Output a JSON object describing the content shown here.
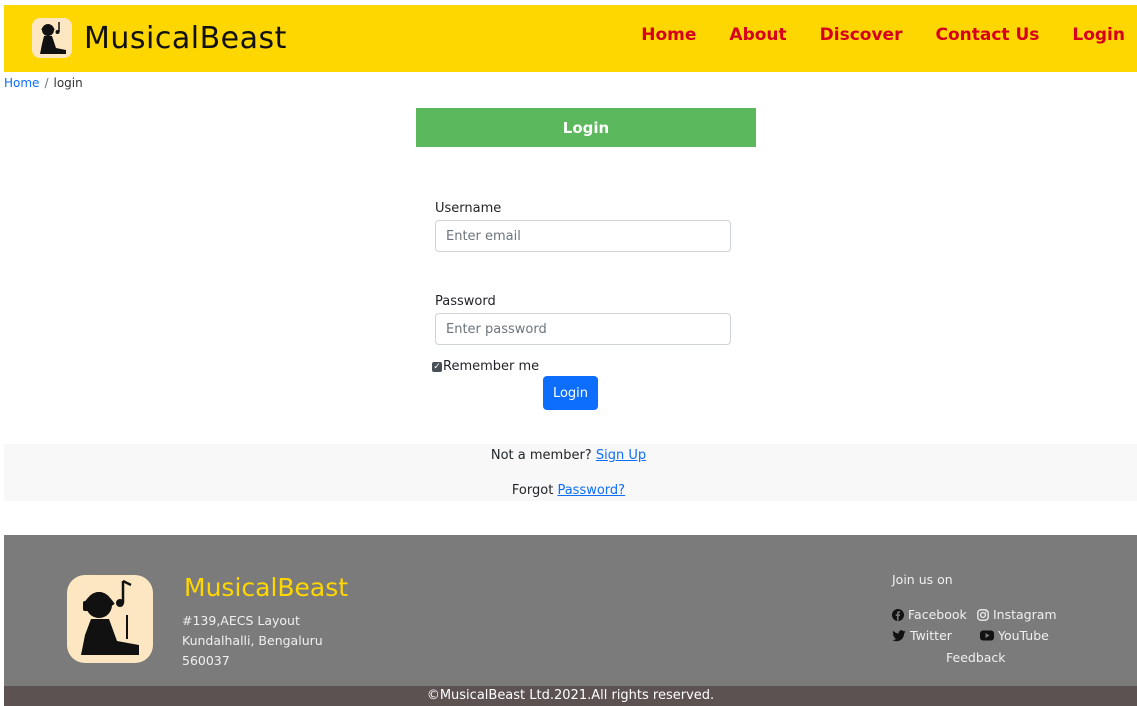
{
  "navbar": {
    "brand": "MusicalBeast",
    "links": [
      "Home",
      "About",
      "Discover",
      "Contact Us",
      "Login"
    ],
    "bg_color": "#ffd700",
    "link_color": "#d6001c"
  },
  "breadcrumb": {
    "home": "Home",
    "separator": "/",
    "current": "login"
  },
  "login_form": {
    "header": "Login",
    "username_label": "Username",
    "username_placeholder": "Enter email",
    "password_label": "Password",
    "password_placeholder": "Enter password",
    "remember_label": "Remember me",
    "remember_checked": true,
    "submit_label": "Login",
    "header_color": "#5cb85c",
    "button_color": "#0d6efd"
  },
  "signup": {
    "not_member_text": "Not a member?",
    "signup_link": "Sign Up",
    "forgot_text": "Forgot",
    "password_link": "Password?"
  },
  "footer": {
    "brand": "MusicalBeast",
    "address_line1": "#139,AECS Layout",
    "address_line2": "Kundalhalli, Bengaluru",
    "address_line3": "560037",
    "join_label": "Join us on",
    "facebook": "Facebook",
    "instagram": "Instagram",
    "twitter": "Twitter",
    "youtube": "YouTube",
    "feedback": "Feedback",
    "copyright": "©MusicalBeast Ltd.2021.All rights reserved.",
    "bg_color": "#7b7b7b"
  }
}
